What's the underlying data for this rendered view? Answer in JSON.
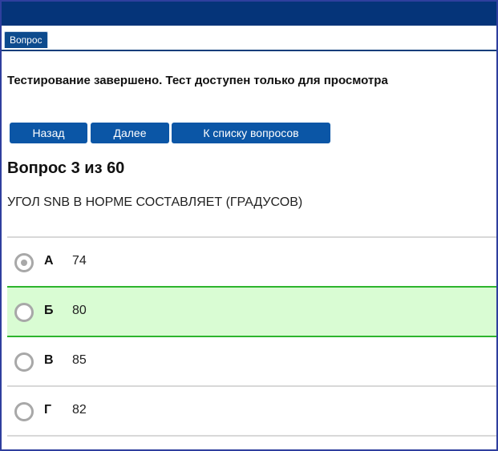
{
  "tab": {
    "label": "Вопрос"
  },
  "status_message": "Тестирование завершено. Тест доступен только для просмотра",
  "nav": {
    "back_label": "Назад",
    "next_label": "Далее",
    "list_label": "К списку вопросов"
  },
  "question": {
    "number_label": "Вопрос 3 из 60",
    "text": "УГОЛ SNB В НОРМЕ СОСТАВЛЯЕТ (ГРАДУСОВ)"
  },
  "answers": [
    {
      "letter": "А",
      "value": "74",
      "selected": true,
      "correct": false
    },
    {
      "letter": "Б",
      "value": "80",
      "selected": false,
      "correct": true
    },
    {
      "letter": "В",
      "value": "85",
      "selected": false,
      "correct": false
    },
    {
      "letter": "Г",
      "value": "82",
      "selected": false,
      "correct": false
    }
  ],
  "colors": {
    "header": "#053479",
    "button": "#0b56a6",
    "correct_bg": "#d9fcd3",
    "correct_border": "#2db42d"
  }
}
